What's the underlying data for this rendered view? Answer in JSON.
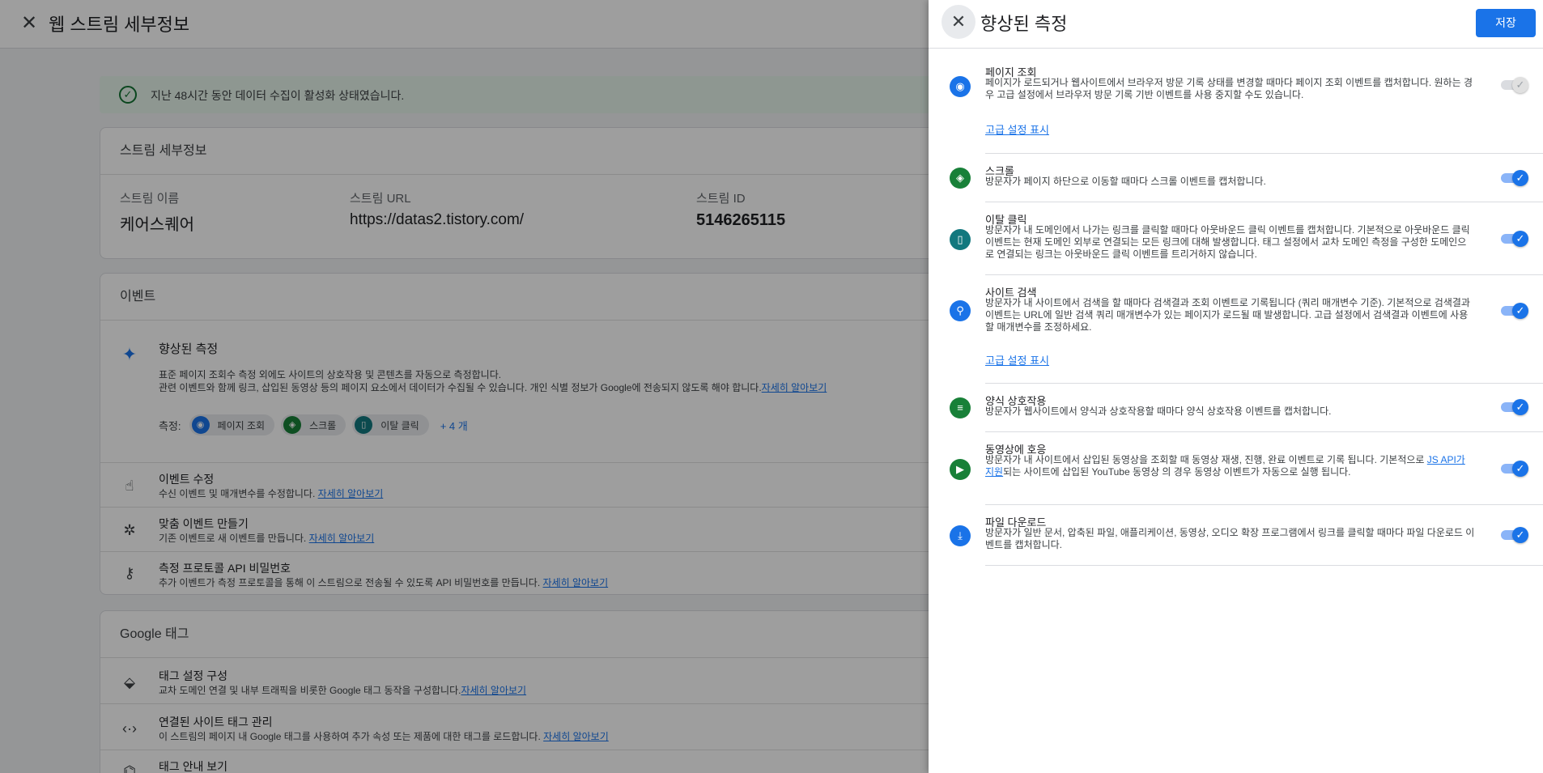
{
  "background": {
    "title": "웹 스트림 세부정보",
    "banner": "지난 48시간 동안 데이터 수집이 활성화 상태였습니다.",
    "stream_details": {
      "header": "스트림 세부정보",
      "name_label": "스트림 이름",
      "name_value": "케어스퀘어",
      "url_label": "스트림 URL",
      "url_value": "https://datas2.tistory.com/",
      "id_label": "스트림 ID",
      "id_value": "5146265115"
    },
    "events": {
      "header": "이벤트",
      "enhanced": {
        "title": "향상된 측정",
        "desc1": "표준 페이지 조회수 측정 외에도 사이트의 상호작용 및 콘텐츠를 자동으로 측정합니다.",
        "desc2": "관련 이벤트와 함께 링크, 삽입된 동영상 등의 페이지 요소에서 데이터가 수집될 수 있습니다. 개인 식별 정보가 Google에 전송되지 않도록 해야 합니다.",
        "learn_more": "자세히 알아보기",
        "measure_label": "측정:",
        "chips": [
          "페이지 조회",
          "스크롤",
          "이탈 클릭"
        ],
        "more": "+ 4 개"
      },
      "modify": {
        "title": "이벤트 수정",
        "desc": "수신 이벤트 및 매개변수를 수정합니다.",
        "link": "자세히 알아보기"
      },
      "create": {
        "title": "맞춤 이벤트 만들기",
        "desc": "기존 이벤트로 새 이벤트를 만듭니다.",
        "link": "자세히 알아보기"
      },
      "secret": {
        "title": "측정 프로토콜 API 비밀번호",
        "desc": "추가 이벤트가 측정 프로토콜을 통해 이 스트림으로 전송될 수 있도록 API 비밀번호를 만듭니다.",
        "link": "자세히 알아보기"
      }
    },
    "google_tag": {
      "header": "Google 태그",
      "config": {
        "title": "태그 설정 구성",
        "desc": "교차 도메인 연결 및 내부 트래픽을 비롯한 Google 태그 동작을 구성합니다.",
        "link": "자세히 알아보기"
      },
      "connected": {
        "title": "연결된 사이트 태그 관리",
        "desc": "이 스트림의 페이지 내 Google 태그를 사용하여 추가 속성 또는 제품에 대한 태그를 로드합니다.",
        "link": "자세히 알아보기"
      },
      "guide": {
        "title": "태그 안내 보기"
      }
    }
  },
  "panel": {
    "title": "향상된 측정",
    "save": "저장",
    "advanced_link": "고급 설정 표시",
    "items": [
      {
        "title": "페이지 조회",
        "desc": "페이지가 로드되거나 웹사이트에서 브라우저 방문 기록 상태를 변경할 때마다 페이지 조회 이벤트를 캡처합니다. 원하는 경우 고급 설정에서 브라우저 방문 기록 기반 이벤트를 사용 중지할 수도 있습니다.",
        "enabled": true,
        "locked": true,
        "icon": "eye-icon",
        "color": "#1a73e8"
      },
      {
        "title": "스크롤",
        "desc": "방문자가 페이지 하단으로 이동할 때마다 스크롤 이벤트를 캡처합니다.",
        "enabled": true,
        "icon": "scroll-icon",
        "color": "#188038"
      },
      {
        "title": "이탈 클릭",
        "desc": "방문자가 내 도메인에서 나가는 링크를 클릭할 때마다 아웃바운드 클릭 이벤트를 캡처합니다. 기본적으로 아웃바운드 클릭 이벤트는 현재 도메인 외부로 연결되는 모든 링크에 대해 발생합니다. 태그 설정에서 교차 도메인 측정을 구성한 도메인으로 연결되는 링크는 아웃바운드 클릭 이벤트를 트리거하지 않습니다.",
        "enabled": true,
        "icon": "mouse-icon",
        "color": "#12787e"
      },
      {
        "title": "사이트 검색",
        "desc": "방문자가 내 사이트에서 검색을 할 때마다 검색결과 조회 이벤트로 기록됩니다 (쿼리 매개변수 기준). 기본적으로 검색결과 이벤트는 URL에 일반 검색 쿼리 매개변수가 있는 페이지가 로드될 때 발생합니다. 고급 설정에서 검색결과 이벤트에 사용할 매개변수를 조정하세요.",
        "enabled": true,
        "icon": "search-icon",
        "color": "#1a73e8"
      },
      {
        "title": "양식 상호작용",
        "desc": "방문자가 웹사이트에서 양식과 상호작용할 때마다 양식 상호작용 이벤트를 캡처합니다.",
        "enabled": true,
        "icon": "form-icon",
        "color": "#188038"
      },
      {
        "title": "동영상에 호응",
        "desc_pre": "방문자가 내 사이트에서 삽입된 동영상을 조회할 때 동영상 재생, 진행, 완료 이벤트로 기록 됩니다. 기본적으로 ",
        "desc_link": "JS API가 지원",
        "desc_post": "되는 사이트에 삽입된 YouTube 동영상 의 경우 동영상 이벤트가 자동으로 실행 됩니다.",
        "enabled": true,
        "icon": "play-icon",
        "color": "#188038"
      },
      {
        "title": "파일 다운로드",
        "desc": "방문자가 일반 문서, 압축된 파일, 애플리케이션, 동영상, 오디오 확장 프로그램에서 링크를 클릭할 때마다 파일 다운로드 이벤트를 캡처합니다.",
        "enabled": true,
        "icon": "download-icon",
        "color": "#1a73e8"
      }
    ]
  }
}
